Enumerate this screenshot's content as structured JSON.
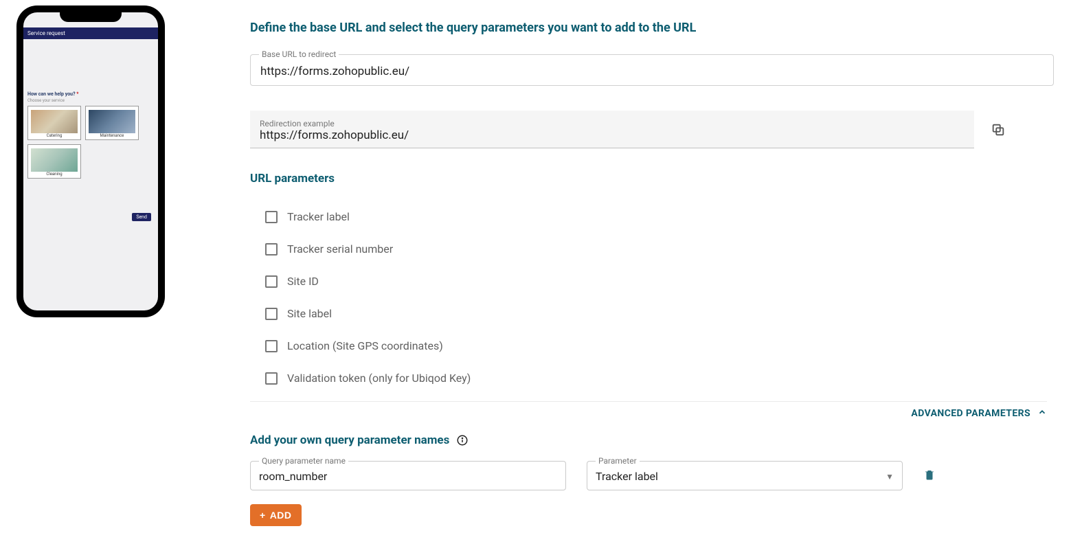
{
  "phone": {
    "title": "Service request",
    "question": "How can we help you?",
    "hint": "Choose your service",
    "tiles": [
      "Catering",
      "Maintenance",
      "Cleaning"
    ],
    "send": "Send"
  },
  "header": {
    "title": "Define the base URL and select the query parameters you want to add to the URL"
  },
  "baseUrl": {
    "label": "Base URL to redirect",
    "value": "https://forms.zohopublic.eu/"
  },
  "example": {
    "label": "Redirection example",
    "value": "https://forms.zohopublic.eu/"
  },
  "paramsSection": {
    "title": "URL parameters"
  },
  "checkboxes": [
    "Tracker label",
    "Tracker serial number",
    "Site ID",
    "Site label",
    "Location (Site GPS coordinates)",
    "Validation token (only for Ubiqod Key)"
  ],
  "advanced": {
    "label": "ADVANCED PARAMETERS"
  },
  "ownParams": {
    "title": "Add your own query parameter names",
    "nameLabel": "Query parameter name",
    "nameValue": "room_number",
    "paramLabel": "Parameter",
    "paramValue": "Tracker label"
  },
  "addButton": {
    "label": "ADD"
  }
}
